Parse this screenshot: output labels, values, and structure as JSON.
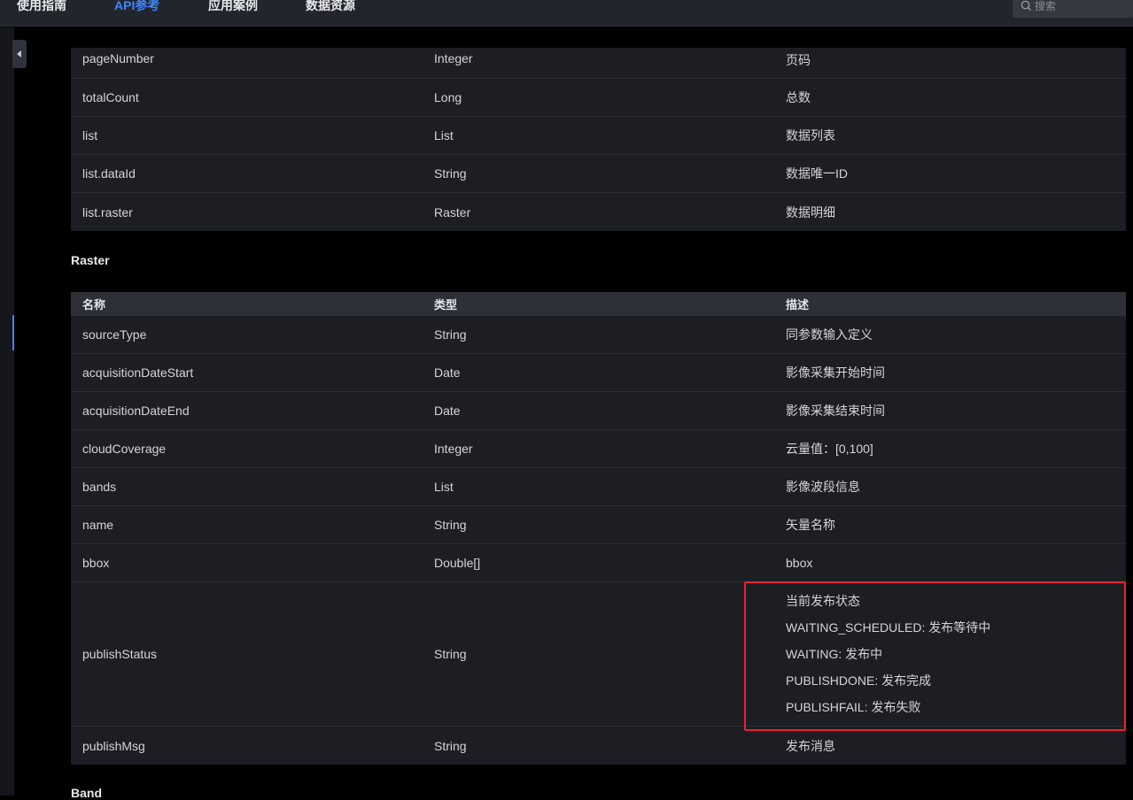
{
  "nav": {
    "items": [
      "使用指南",
      "API参考",
      "应用案例",
      "数据资源"
    ],
    "active_index": 1,
    "search_placeholder": "搜索"
  },
  "colors": {
    "accent": "#3d86ff",
    "highlight": "#e8252b"
  },
  "table_top": {
    "rows": [
      {
        "name": "pageNumber",
        "type": "Integer",
        "desc": "页码"
      },
      {
        "name": "totalCount",
        "type": "Long",
        "desc": "总数"
      },
      {
        "name": "list",
        "type": "List",
        "desc": "数据列表"
      },
      {
        "name": "list.dataId",
        "type": "String",
        "desc": "数据唯一ID"
      },
      {
        "name": "list.raster",
        "type": "Raster",
        "desc": "数据明细"
      }
    ]
  },
  "raster_section": {
    "title": "Raster",
    "headers": [
      "名称",
      "类型",
      "描述"
    ],
    "rows": [
      {
        "name": "sourceType",
        "type": "String",
        "desc": "同参数输入定义"
      },
      {
        "name": "acquisitionDateStart",
        "type": "Date",
        "desc": "影像采集开始时间"
      },
      {
        "name": "acquisitionDateEnd",
        "type": "Date",
        "desc": "影像采集结束时间"
      },
      {
        "name": "cloudCoverage",
        "type": "Integer",
        "desc": "云量值：[0,100]"
      },
      {
        "name": "bands",
        "type": "List",
        "desc": "影像波段信息"
      },
      {
        "name": "name",
        "type": "String",
        "desc": "矢量名称"
      },
      {
        "name": "bbox",
        "type": "Double[]",
        "desc": "bbox"
      }
    ],
    "publish_status": {
      "name": "publishStatus",
      "type": "String",
      "desc_lines": [
        "当前发布状态",
        "WAITING_SCHEDULED: 发布等待中",
        "WAITING: 发布中",
        "PUBLISHDONE: 发布完成",
        "PUBLISHFAIL: 发布失败"
      ]
    },
    "publish_msg": {
      "name": "publishMsg",
      "type": "String",
      "desc": "发布消息"
    }
  },
  "next_section": {
    "title": "Band"
  }
}
